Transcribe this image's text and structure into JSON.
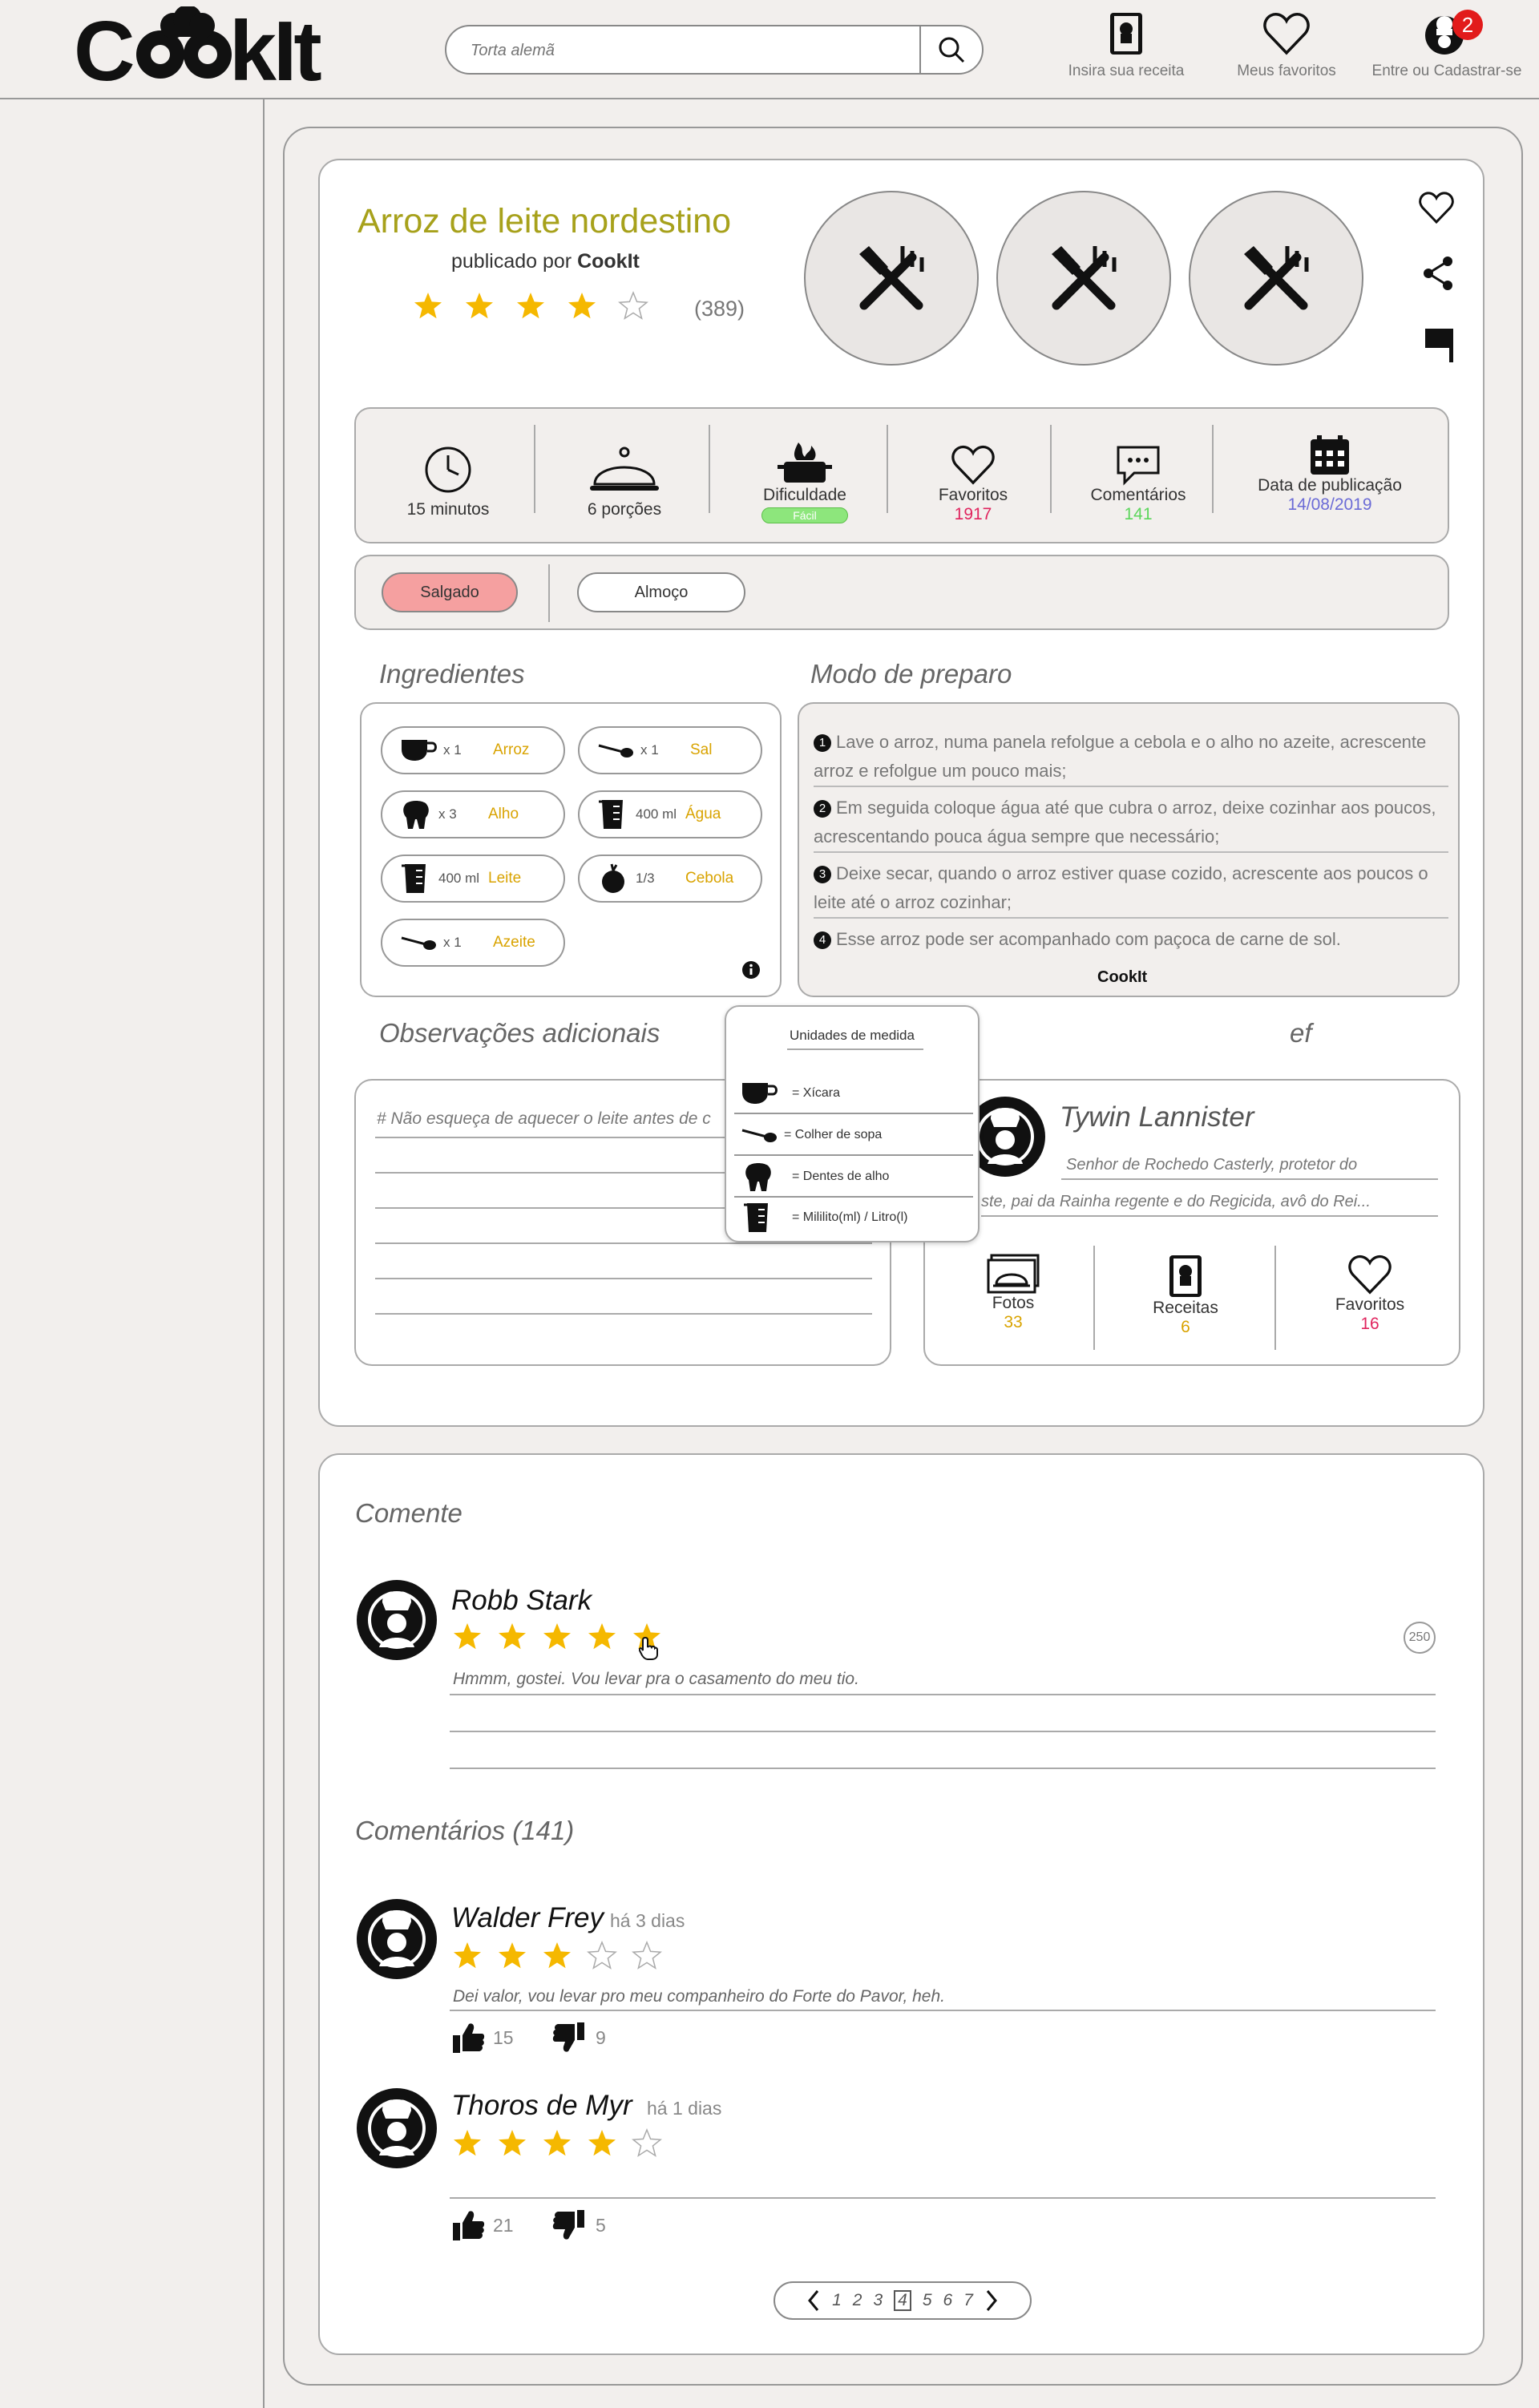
{
  "app": {
    "brand": "CookIt"
  },
  "search": {
    "placeholder": "Torta alemã"
  },
  "nav": {
    "insert_recipe": "Insira sua receita",
    "favorites": "Meus favoritos",
    "login": "Entre ou Cadastrar-se",
    "notification_count": "2"
  },
  "recipe": {
    "title": "Arroz de leite nordestino",
    "published_prefix": "publicado por ",
    "published_by": "CookIt",
    "rating": 4,
    "rating_count": "(389)",
    "stats": {
      "time": "15 minutos",
      "portions": "6 porções",
      "difficulty_label": "Dificuldade",
      "difficulty_value": "Fácil",
      "favorites_label": "Favoritos",
      "favorites_value": "1917",
      "comments_label": "Comentários",
      "comments_value": "141",
      "date_label": "Data de publicação",
      "date_value": "14/08/2019"
    },
    "tags": [
      "Salgado",
      "Almoço"
    ]
  },
  "ingredients": {
    "title": "Ingredientes",
    "items": [
      {
        "qty": "x 1",
        "name": "Arroz",
        "icon": "cup-icon"
      },
      {
        "qty": "x 1",
        "name": "Sal",
        "icon": "spoon-icon"
      },
      {
        "qty": "x 3",
        "name": "Alho",
        "icon": "garlic-icon"
      },
      {
        "qty": "400 ml",
        "name": "Água",
        "icon": "measuring-cup-icon"
      },
      {
        "qty": "400 ml",
        "name": "Leite",
        "icon": "measuring-cup-icon"
      },
      {
        "qty": "1/3",
        "name": "Cebola",
        "icon": "onion-icon"
      },
      {
        "qty": "x 1",
        "name": "Azeite",
        "icon": "spoon-icon"
      }
    ]
  },
  "preparation": {
    "title": "Modo de preparo",
    "steps": [
      "Lave o arroz, numa panela refolgue a cebola e o alho no azeite, acrescente arroz e refolgue um pouco mais;",
      "Em seguida coloque água até que cubra o arroz, deixe cozinhar aos poucos, acrescentando pouca água sempre que necessário;",
      "Deixe secar, quando o arroz estiver quase cozido, acrescente aos poucos o leite até o arroz cozinhar;",
      "Esse arroz pode ser acompanhado com paçoca de carne de sol."
    ],
    "brand": "CookIt"
  },
  "units_popup": {
    "title": "Unidades de medida",
    "items": [
      "= Xícara",
      "= Colher de sopa",
      "= Dentes de alho",
      "= Mililito(ml) / Litro(l)"
    ]
  },
  "notes": {
    "title": "Observações adicionais",
    "text": "# Não esqueça de aquecer o leite antes de c"
  },
  "chef": {
    "title_fragment": "ef",
    "name": "Tywin Lannister",
    "bio_line1": "Senhor de Rochedo Casterly, protetor do",
    "bio_line2": "ste, pai da Rainha regente e do Regicida, avô do Rei...",
    "photos_label": "Fotos",
    "photos_value": "33",
    "recipes_label": "Receitas",
    "recipes_value": "6",
    "favorites_label": "Favoritos",
    "favorites_value": "16"
  },
  "comment_form": {
    "title": "Comente",
    "user": "Robb Stark",
    "rating": 5,
    "text": "Hmmm, gostei. Vou levar pra o casamento do meu tio.",
    "char_count": "250"
  },
  "comments": {
    "title": "Comentários (141)",
    "items": [
      {
        "user": "Walder Frey",
        "ago": "há 3 dias",
        "rating": 3,
        "text": "Dei valor, vou levar pro meu companheiro do Forte do Pavor, heh.",
        "likes": "15",
        "dislikes": "9"
      },
      {
        "user": "Thoros de Myr",
        "ago": "há 1 dias",
        "rating": 4,
        "text": "",
        "likes": "21",
        "dislikes": "5"
      }
    ]
  },
  "pagination": {
    "pages": [
      "1",
      "2",
      "3",
      "4",
      "5",
      "6",
      "7"
    ],
    "current": "4"
  },
  "colors": {
    "star": "#f5b800",
    "title": "#a7a11b",
    "accent_orange": "#d9a300",
    "favorites": "#e0245e",
    "comments": "#5cd65c",
    "date": "#6b6bd6",
    "tag_active": "#f5a0a0",
    "notification": "#e21b1b"
  }
}
